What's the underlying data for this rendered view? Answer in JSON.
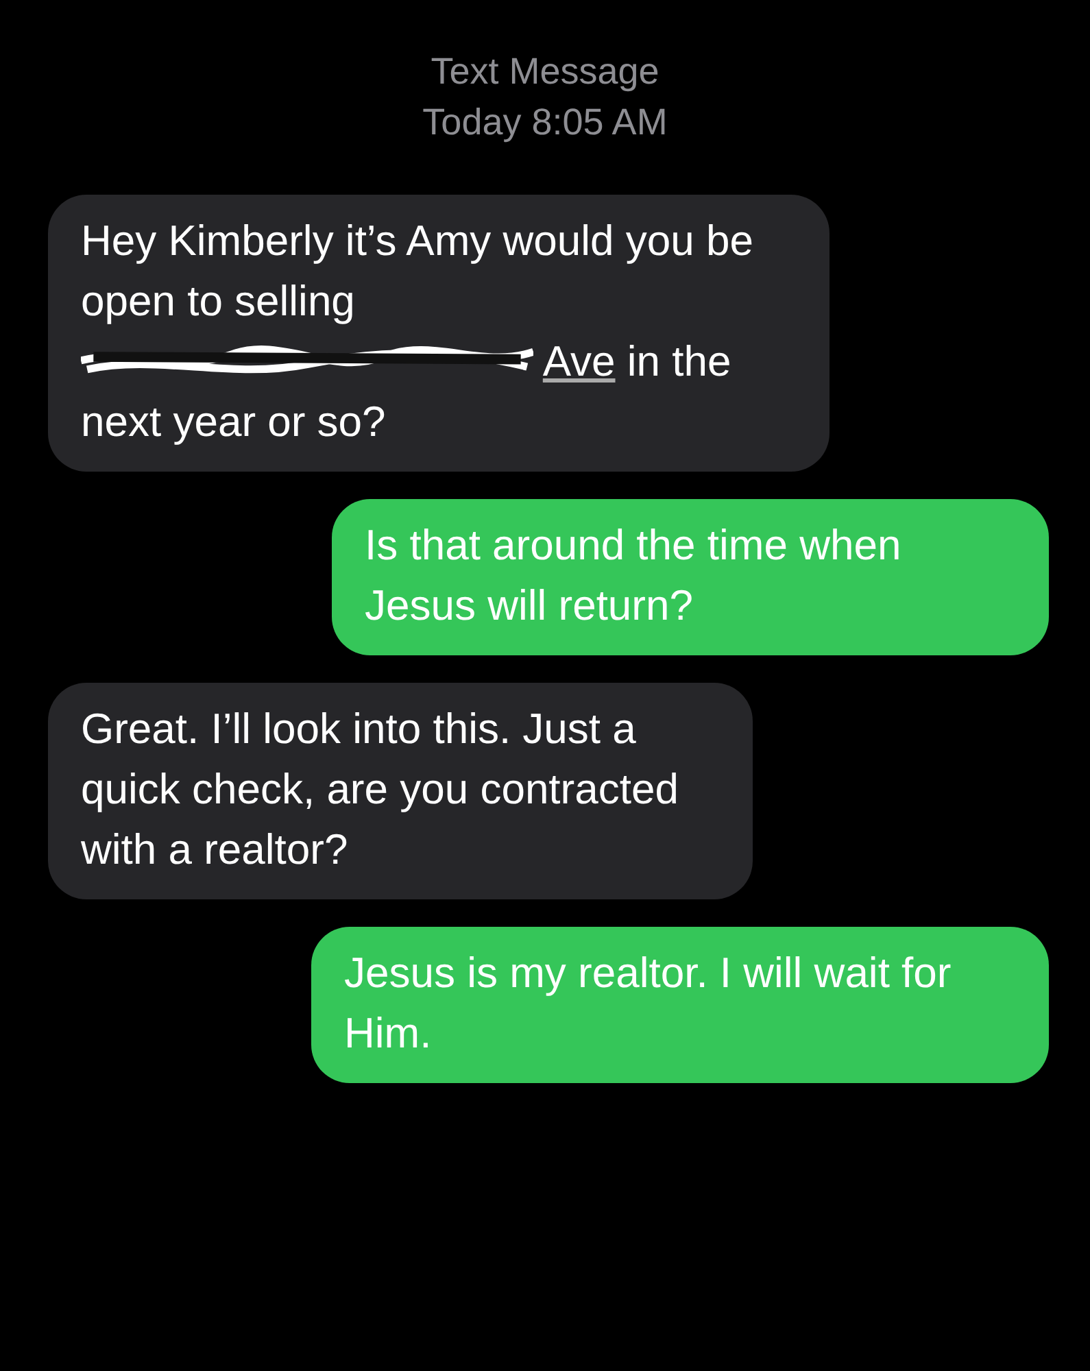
{
  "header": {
    "title": "Text Message",
    "time_prefix": "Today",
    "time": "8:05 AM"
  },
  "messages": [
    {
      "kind": "received",
      "text": "Hey Kimberly it’s Amy would you be open to selling",
      "redacted": true,
      "link_text": "Ave",
      "text_after": "in the next year or so?"
    },
    {
      "kind": "sent",
      "text": "Is that around the time when Jesus will return?",
      "redacted": false
    },
    {
      "kind": "received",
      "text": "Great. I’ll look into this. Just a quick check, are you contracted with a realtor?",
      "redacted": false
    },
    {
      "kind": "sent",
      "text": "Jesus is my realtor. I will wait for Him.",
      "redacted": false
    }
  ]
}
